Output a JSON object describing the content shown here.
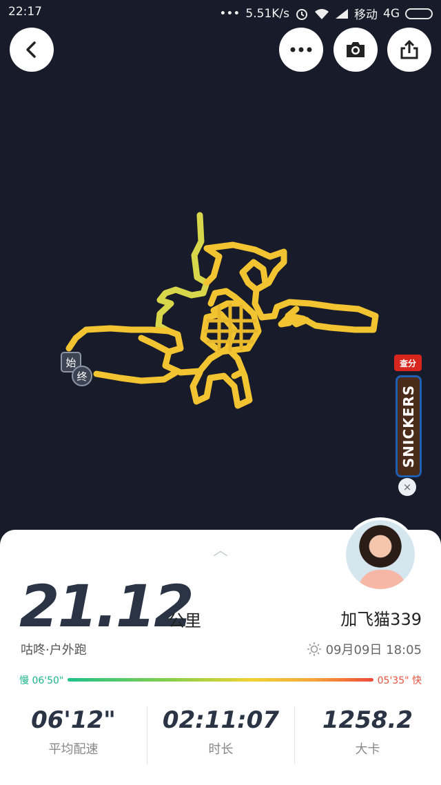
{
  "status_bar": {
    "time": "22:17",
    "dots": "•••",
    "network_speed": "5.51K/s",
    "carrier": "移动",
    "network_type": "4G"
  },
  "toolbar": {
    "back_icon": "chevron-left-icon",
    "more_icon": "more-icon",
    "camera_icon": "camera-icon",
    "share_icon": "share-icon"
  },
  "map": {
    "start_label": "始",
    "end_label": "终",
    "route_color": "#f2c431",
    "route_start_color": "#d6d84a"
  },
  "ad": {
    "tag": "查分",
    "brand": "SNICKERS",
    "close": "×"
  },
  "summary": {
    "handle": "︿",
    "distance": "21.12",
    "unit": "公里",
    "username": "加飞猫339",
    "sport_type": "咕咚·户外跑",
    "datetime": "09月09日 18:05",
    "pace_slow": "慢 06'50\"",
    "pace_fast": "05'35\" 快"
  },
  "stats": [
    {
      "value": "06'12\"",
      "label": "平均配速"
    },
    {
      "value": "02:11:07",
      "label": "时长"
    },
    {
      "value": "1258.2",
      "label": "大卡"
    }
  ]
}
